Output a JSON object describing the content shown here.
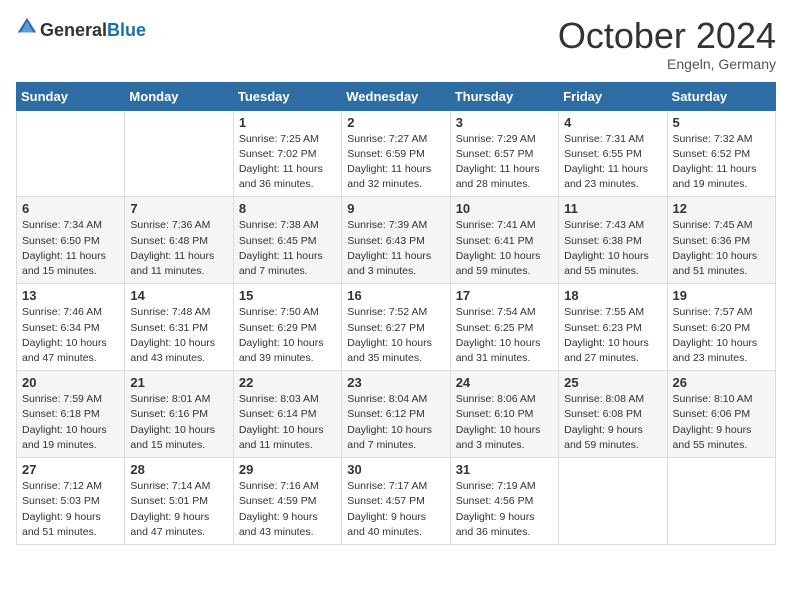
{
  "logo": {
    "text_general": "General",
    "text_blue": "Blue"
  },
  "title": "October 2024",
  "location": "Engeln, Germany",
  "days_of_week": [
    "Sunday",
    "Monday",
    "Tuesday",
    "Wednesday",
    "Thursday",
    "Friday",
    "Saturday"
  ],
  "weeks": [
    [
      {
        "day": "",
        "sunrise": "",
        "sunset": "",
        "daylight": ""
      },
      {
        "day": "",
        "sunrise": "",
        "sunset": "",
        "daylight": ""
      },
      {
        "day": "1",
        "sunrise": "Sunrise: 7:25 AM",
        "sunset": "Sunset: 7:02 PM",
        "daylight": "Daylight: 11 hours and 36 minutes."
      },
      {
        "day": "2",
        "sunrise": "Sunrise: 7:27 AM",
        "sunset": "Sunset: 6:59 PM",
        "daylight": "Daylight: 11 hours and 32 minutes."
      },
      {
        "day": "3",
        "sunrise": "Sunrise: 7:29 AM",
        "sunset": "Sunset: 6:57 PM",
        "daylight": "Daylight: 11 hours and 28 minutes."
      },
      {
        "day": "4",
        "sunrise": "Sunrise: 7:31 AM",
        "sunset": "Sunset: 6:55 PM",
        "daylight": "Daylight: 11 hours and 23 minutes."
      },
      {
        "day": "5",
        "sunrise": "Sunrise: 7:32 AM",
        "sunset": "Sunset: 6:52 PM",
        "daylight": "Daylight: 11 hours and 19 minutes."
      }
    ],
    [
      {
        "day": "6",
        "sunrise": "Sunrise: 7:34 AM",
        "sunset": "Sunset: 6:50 PM",
        "daylight": "Daylight: 11 hours and 15 minutes."
      },
      {
        "day": "7",
        "sunrise": "Sunrise: 7:36 AM",
        "sunset": "Sunset: 6:48 PM",
        "daylight": "Daylight: 11 hours and 11 minutes."
      },
      {
        "day": "8",
        "sunrise": "Sunrise: 7:38 AM",
        "sunset": "Sunset: 6:45 PM",
        "daylight": "Daylight: 11 hours and 7 minutes."
      },
      {
        "day": "9",
        "sunrise": "Sunrise: 7:39 AM",
        "sunset": "Sunset: 6:43 PM",
        "daylight": "Daylight: 11 hours and 3 minutes."
      },
      {
        "day": "10",
        "sunrise": "Sunrise: 7:41 AM",
        "sunset": "Sunset: 6:41 PM",
        "daylight": "Daylight: 10 hours and 59 minutes."
      },
      {
        "day": "11",
        "sunrise": "Sunrise: 7:43 AM",
        "sunset": "Sunset: 6:38 PM",
        "daylight": "Daylight: 10 hours and 55 minutes."
      },
      {
        "day": "12",
        "sunrise": "Sunrise: 7:45 AM",
        "sunset": "Sunset: 6:36 PM",
        "daylight": "Daylight: 10 hours and 51 minutes."
      }
    ],
    [
      {
        "day": "13",
        "sunrise": "Sunrise: 7:46 AM",
        "sunset": "Sunset: 6:34 PM",
        "daylight": "Daylight: 10 hours and 47 minutes."
      },
      {
        "day": "14",
        "sunrise": "Sunrise: 7:48 AM",
        "sunset": "Sunset: 6:31 PM",
        "daylight": "Daylight: 10 hours and 43 minutes."
      },
      {
        "day": "15",
        "sunrise": "Sunrise: 7:50 AM",
        "sunset": "Sunset: 6:29 PM",
        "daylight": "Daylight: 10 hours and 39 minutes."
      },
      {
        "day": "16",
        "sunrise": "Sunrise: 7:52 AM",
        "sunset": "Sunset: 6:27 PM",
        "daylight": "Daylight: 10 hours and 35 minutes."
      },
      {
        "day": "17",
        "sunrise": "Sunrise: 7:54 AM",
        "sunset": "Sunset: 6:25 PM",
        "daylight": "Daylight: 10 hours and 31 minutes."
      },
      {
        "day": "18",
        "sunrise": "Sunrise: 7:55 AM",
        "sunset": "Sunset: 6:23 PM",
        "daylight": "Daylight: 10 hours and 27 minutes."
      },
      {
        "day": "19",
        "sunrise": "Sunrise: 7:57 AM",
        "sunset": "Sunset: 6:20 PM",
        "daylight": "Daylight: 10 hours and 23 minutes."
      }
    ],
    [
      {
        "day": "20",
        "sunrise": "Sunrise: 7:59 AM",
        "sunset": "Sunset: 6:18 PM",
        "daylight": "Daylight: 10 hours and 19 minutes."
      },
      {
        "day": "21",
        "sunrise": "Sunrise: 8:01 AM",
        "sunset": "Sunset: 6:16 PM",
        "daylight": "Daylight: 10 hours and 15 minutes."
      },
      {
        "day": "22",
        "sunrise": "Sunrise: 8:03 AM",
        "sunset": "Sunset: 6:14 PM",
        "daylight": "Daylight: 10 hours and 11 minutes."
      },
      {
        "day": "23",
        "sunrise": "Sunrise: 8:04 AM",
        "sunset": "Sunset: 6:12 PM",
        "daylight": "Daylight: 10 hours and 7 minutes."
      },
      {
        "day": "24",
        "sunrise": "Sunrise: 8:06 AM",
        "sunset": "Sunset: 6:10 PM",
        "daylight": "Daylight: 10 hours and 3 minutes."
      },
      {
        "day": "25",
        "sunrise": "Sunrise: 8:08 AM",
        "sunset": "Sunset: 6:08 PM",
        "daylight": "Daylight: 9 hours and 59 minutes."
      },
      {
        "day": "26",
        "sunrise": "Sunrise: 8:10 AM",
        "sunset": "Sunset: 6:06 PM",
        "daylight": "Daylight: 9 hours and 55 minutes."
      }
    ],
    [
      {
        "day": "27",
        "sunrise": "Sunrise: 7:12 AM",
        "sunset": "Sunset: 5:03 PM",
        "daylight": "Daylight: 9 hours and 51 minutes."
      },
      {
        "day": "28",
        "sunrise": "Sunrise: 7:14 AM",
        "sunset": "Sunset: 5:01 PM",
        "daylight": "Daylight: 9 hours and 47 minutes."
      },
      {
        "day": "29",
        "sunrise": "Sunrise: 7:16 AM",
        "sunset": "Sunset: 4:59 PM",
        "daylight": "Daylight: 9 hours and 43 minutes."
      },
      {
        "day": "30",
        "sunrise": "Sunrise: 7:17 AM",
        "sunset": "Sunset: 4:57 PM",
        "daylight": "Daylight: 9 hours and 40 minutes."
      },
      {
        "day": "31",
        "sunrise": "Sunrise: 7:19 AM",
        "sunset": "Sunset: 4:56 PM",
        "daylight": "Daylight: 9 hours and 36 minutes."
      },
      {
        "day": "",
        "sunrise": "",
        "sunset": "",
        "daylight": ""
      },
      {
        "day": "",
        "sunrise": "",
        "sunset": "",
        "daylight": ""
      }
    ]
  ]
}
